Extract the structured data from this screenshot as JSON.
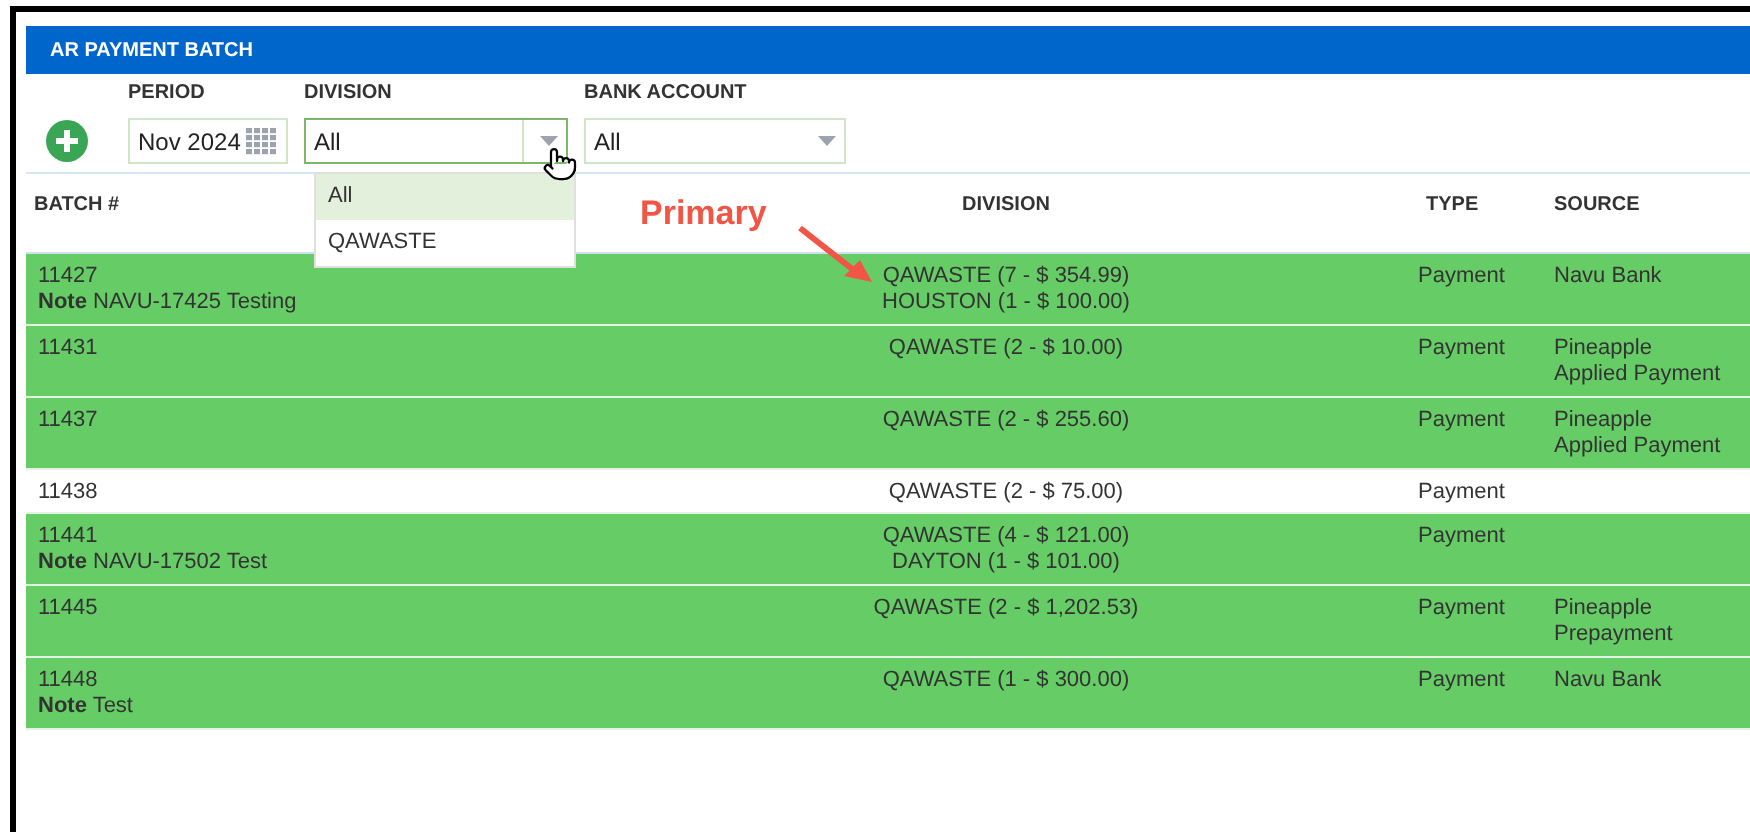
{
  "title": "AR PAYMENT BATCH",
  "filters": [
    {
      "kind": "date",
      "label": "PERIOD",
      "value": "Nov 2024"
    },
    {
      "kind": "select",
      "label": "DIVISION",
      "value": "All",
      "expanded": true,
      "options": [
        {
          "label": "All",
          "selected": true
        },
        {
          "label": "QAWASTE",
          "selected": false
        }
      ]
    },
    {
      "kind": "select",
      "label": "BANK ACCOUNT",
      "value": "All",
      "expanded": false
    }
  ],
  "annotation": "Primary",
  "table": {
    "columns": [
      "BATCH #",
      "DIVISION",
      "TYPE",
      "SOURCE"
    ],
    "rows": [
      {
        "batch": "11427",
        "note_label": "Note",
        "note": "NAVU-17425 Testing",
        "divisions": [
          "QAWASTE (7 - $ 354.99)",
          "HOUSTON (1 - $ 100.00)"
        ],
        "type": "Payment",
        "source": [
          "Navu Bank"
        ],
        "highlighted": true
      },
      {
        "batch": "11431",
        "divisions": [
          "QAWASTE (2 - $ 10.00)"
        ],
        "type": "Payment",
        "source": [
          "Pineapple",
          "Applied Payment"
        ],
        "highlighted": true
      },
      {
        "batch": "11437",
        "divisions": [
          "QAWASTE (2 - $ 255.60)"
        ],
        "type": "Payment",
        "source": [
          "Pineapple",
          "Applied Payment"
        ],
        "highlighted": true
      },
      {
        "batch": "11438",
        "divisions": [
          "QAWASTE (2 - $ 75.00)"
        ],
        "type": "Payment",
        "highlighted": false
      },
      {
        "batch": "11441",
        "note_label": "Note",
        "note": "NAVU-17502 Test",
        "divisions": [
          "QAWASTE (4 - $ 121.00)",
          "DAYTON (1 - $ 101.00)"
        ],
        "type": "Payment",
        "highlighted": true
      },
      {
        "batch": "11445",
        "divisions": [
          "QAWASTE (2 - $ 1,202.53)"
        ],
        "type": "Payment",
        "source": [
          "Pineapple",
          "Prepayment"
        ],
        "highlighted": true
      },
      {
        "batch": "11448",
        "note_label": "Note",
        "note": "Test",
        "divisions": [
          "QAWASTE (1 - $ 300.00)"
        ],
        "type": "Payment",
        "source": [
          "Navu Bank"
        ],
        "highlighted": true
      }
    ]
  }
}
